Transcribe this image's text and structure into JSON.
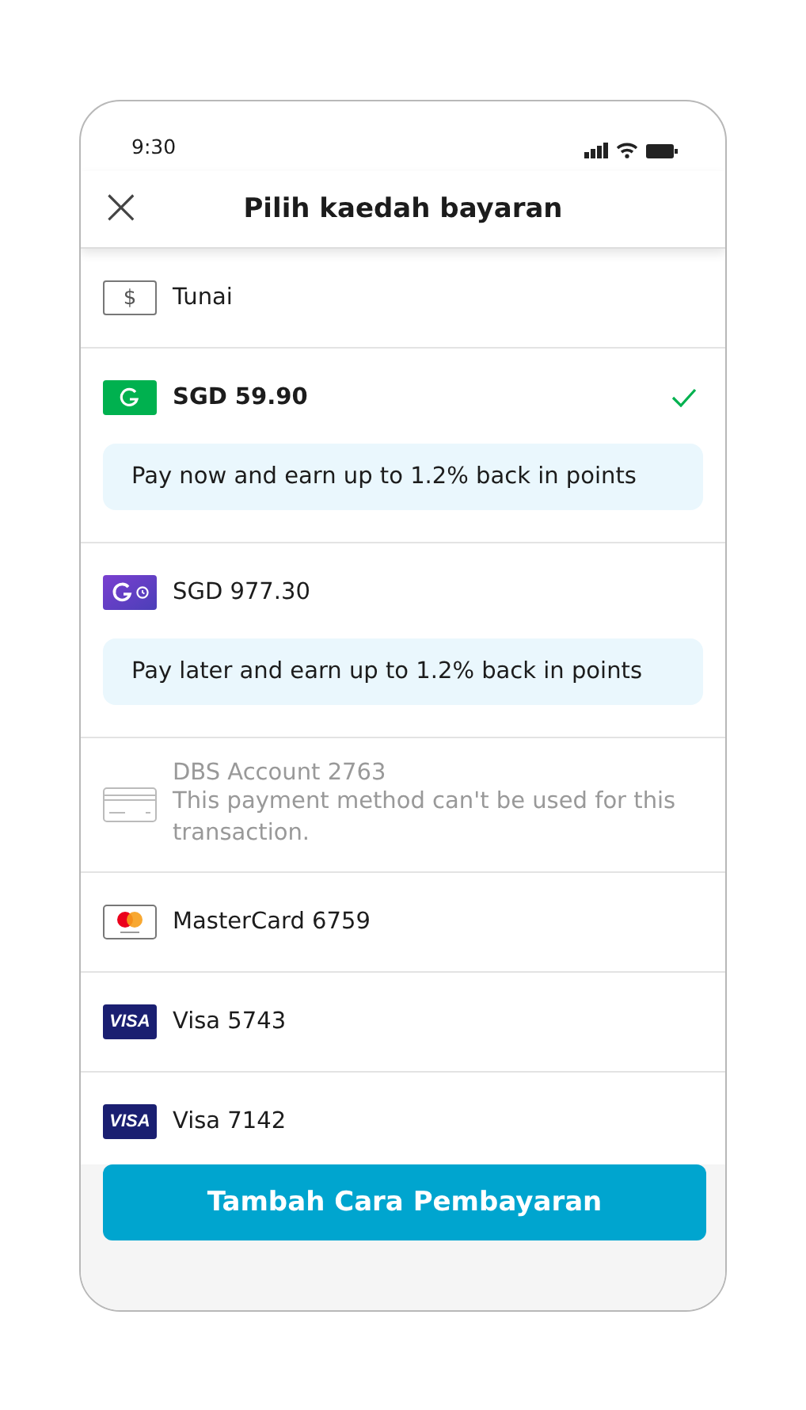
{
  "status_bar": {
    "time": "9:30"
  },
  "header": {
    "close_icon": "×",
    "title": "Pilih kaedah bayaran"
  },
  "methods": [
    {
      "kind": "cash",
      "icon_text": "$",
      "label": "Tunai",
      "selected": false,
      "disabled": false
    },
    {
      "kind": "wallet",
      "label": "SGD 59.90",
      "selected": true,
      "disabled": false,
      "info": "Pay now and earn up to 1.2% back in points"
    },
    {
      "kind": "paylater",
      "label": "SGD 977.30",
      "selected": false,
      "disabled": false,
      "info": "Pay later and earn up to 1.2% back in points"
    },
    {
      "kind": "bank",
      "label": "DBS Account 2763",
      "selected": false,
      "disabled": true,
      "note": "This payment method can't be used for this transaction."
    },
    {
      "kind": "mastercard",
      "label": "MasterCard 6759",
      "selected": false,
      "disabled": false
    },
    {
      "kind": "visa",
      "icon_text": "VISA",
      "label": "Visa 5743",
      "selected": false,
      "disabled": false
    },
    {
      "kind": "visa",
      "icon_text": "VISA",
      "label": "Visa 7142",
      "selected": false,
      "disabled": false
    }
  ],
  "button": {
    "label": "Tambah Cara Pembayaran"
  }
}
